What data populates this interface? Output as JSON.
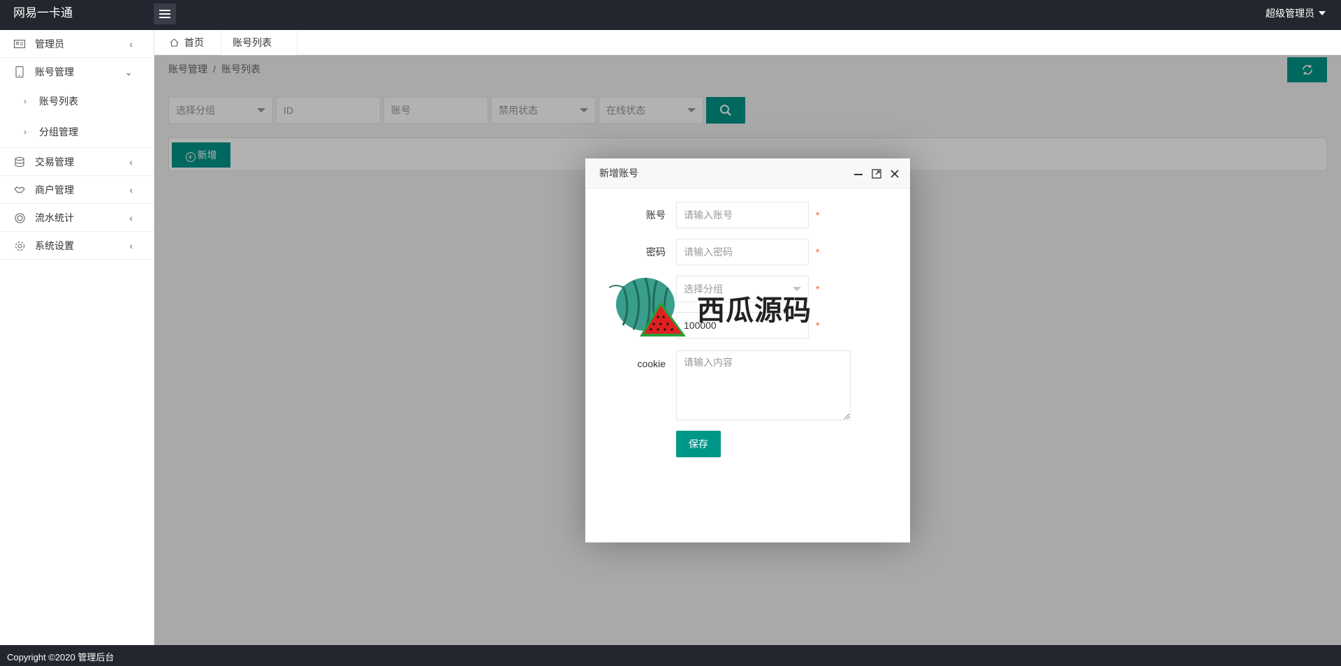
{
  "header": {
    "logo": "网易一卡通",
    "user": "超级管理员"
  },
  "sidebar": {
    "items": [
      {
        "label": "管理员",
        "icon": "id-card-icon",
        "arrow": "‹"
      },
      {
        "label": "账号管理",
        "icon": "phone-icon",
        "arrow": "⌄"
      },
      {
        "label": "账号列表",
        "sub": true
      },
      {
        "label": "分组管理",
        "sub": true
      },
      {
        "label": "交易管理",
        "icon": "database-icon",
        "arrow": "‹"
      },
      {
        "label": "商户管理",
        "icon": "handshake-icon",
        "arrow": "‹"
      },
      {
        "label": "流水统计",
        "icon": "chart-circle-icon",
        "arrow": "‹"
      },
      {
        "label": "系统设置",
        "icon": "gear-icon",
        "arrow": "‹"
      }
    ]
  },
  "tabs": {
    "home": "首页",
    "active": "账号列表",
    "close": "✕"
  },
  "breadcrumb": {
    "parent": "账号管理",
    "sep": "/",
    "current": "账号列表"
  },
  "filters": {
    "group": "选择分组",
    "id": "ID",
    "account": "账号",
    "disabled": "禁用状态",
    "online": "在线状态"
  },
  "toolbar": {
    "add": "新增"
  },
  "dialog": {
    "title": "新增账号",
    "fields": {
      "account": {
        "label": "账号",
        "placeholder": "请输入账号"
      },
      "password": {
        "label": "密码",
        "placeholder": "请输入密码"
      },
      "group": {
        "label": "",
        "placeholder": "选择分组"
      },
      "amount": {
        "label": "",
        "value": "100000"
      },
      "cookie": {
        "label": "cookie",
        "placeholder": "请输入内容"
      }
    },
    "required_mark": "*",
    "save": "保存"
  },
  "watermark": {
    "text": "西瓜源码"
  },
  "footer": {
    "copyright": "Copyright ©2020 管理后台"
  },
  "colors": {
    "primary": "#009688",
    "header_bg": "#23262e",
    "required": "#ff5722"
  }
}
